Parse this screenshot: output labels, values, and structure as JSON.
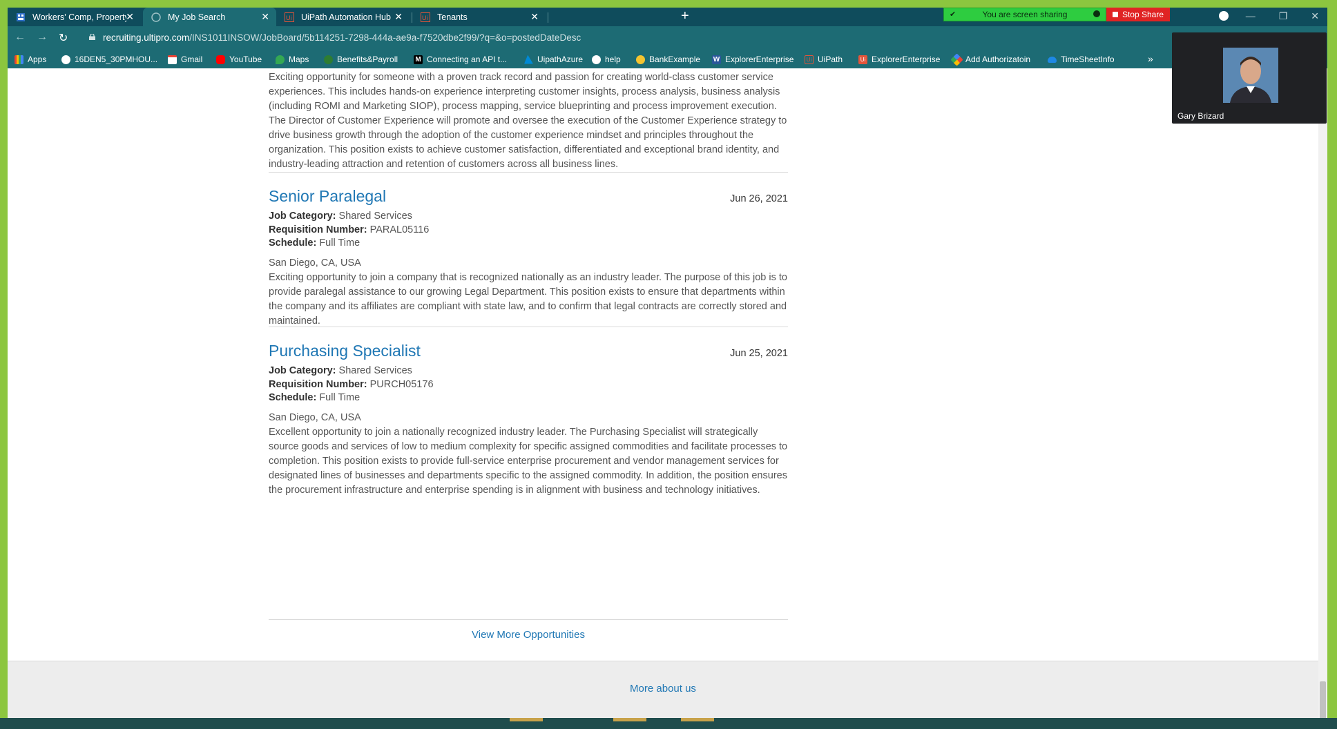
{
  "browser": {
    "tabs": [
      {
        "title": "Workers' Comp, Property & Auto",
        "active": false
      },
      {
        "title": "My Job Search",
        "active": true
      },
      {
        "title": "UiPath Automation Hub",
        "active": false
      },
      {
        "title": "Tenants",
        "active": false
      }
    ],
    "new_tab": "+",
    "url_domain": "recruiting.ultipro.com",
    "url_path": "/INS1011INSOW/JobBoard/5b114251-7298-444a-ae9a-f7520dbe2f99/?q=&o=postedDateDesc",
    "bookmarks": [
      "Apps",
      "16DEN5_30PMHOU...",
      "Gmail",
      "YouTube",
      "Maps",
      "Benefits&Payroll",
      "Connecting an API t...",
      "UipathAzure",
      "help",
      "BankExample",
      "ExplorerEnterprise",
      "UiPath",
      "ExplorerEnterprise",
      "Add Authorizatoin",
      "TimeSheetInfo"
    ],
    "bookmarks_overflow": "»"
  },
  "screen_share": {
    "status": "You are screen sharing",
    "stop_label": "Stop Share"
  },
  "video": {
    "participant_name": "Gary Brizard"
  },
  "jobs": {
    "first_description": "Exciting opportunity for someone with a proven track record and passion for creating world-class customer service experiences. This includes hands-on experience interpreting customer insights, process analysis, business analysis (including ROMI and Marketing SIOP), process mapping, service blueprinting and process improvement execution. The Director of Customer Experience will promote and oversee the execution of the Customer Experience strategy to drive business growth through the adoption of the customer experience mindset and principles throughout the organization.  This position exists to achieve customer satisfaction, differentiated and exceptional brand identity, and industry-leading attraction and retention of customers across all business lines.",
    "items": [
      {
        "title": "Senior Paralegal",
        "date": "Jun 26, 2021",
        "category_label": "Job Category:",
        "category": "Shared Services",
        "req_label": "Requisition Number:",
        "req": "PARAL05116",
        "schedule_label": "Schedule:",
        "schedule": "Full Time",
        "location": "San Diego, CA, USA",
        "description": "Exciting opportunity to join a company that is recognized nationally as an industry leader. The purpose of this job is to provide paralegal assistance to our growing Legal Department. This position exists to ensure that departments within the company and its affiliates are compliant with state law, and to confirm that legal contracts are correctly stored and maintained."
      },
      {
        "title": "Purchasing Specialist",
        "date": "Jun 25, 2021",
        "category_label": "Job Category:",
        "category": "Shared Services",
        "req_label": "Requisition Number:",
        "req": "PURCH05176",
        "schedule_label": "Schedule:",
        "schedule": "Full Time",
        "location": "San Diego, CA, USA",
        "description": "Excellent opportunity to join a nationally recognized industry leader. The Purchasing Specialist will strategically source goods and services of low to medium complexity for specific assigned commodities and facilitate processes to completion.  This position exists to provide full-service enterprise procurement and vendor management services for designated lines of businesses and departments specific to the assigned commodity. In addition, the position ensures the procurement infrastructure and enterprise spending is in alignment with business and technology initiatives."
      }
    ],
    "view_more": "View More Opportunities"
  },
  "footer": {
    "more_about": "More about us"
  },
  "colors": {
    "frame_border": "#8cc63f",
    "tab_bar": "#0f4c5c",
    "toolbar": "#1d6b74",
    "link": "#1f77b4"
  }
}
